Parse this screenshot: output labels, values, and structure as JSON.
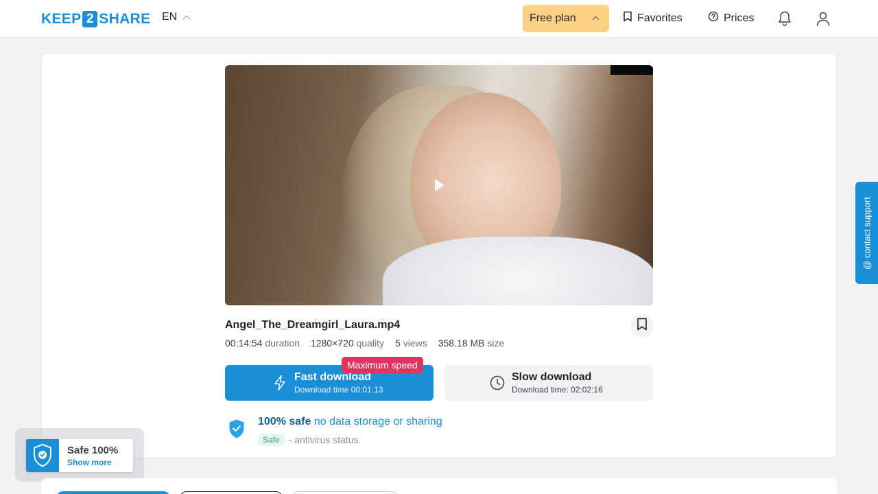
{
  "header": {
    "logo": {
      "left": "KEEP",
      "mid": "2",
      "right": "SHARE"
    },
    "language": "EN",
    "free_plan": "Free plan",
    "favorites": "Favorites",
    "prices": "Prices"
  },
  "file": {
    "name": "Angel_The_Dreamgirl_Laura.mp4",
    "duration_value": "00:14:54",
    "duration_label": "duration",
    "quality_value": "1280×720",
    "quality_label": "quality",
    "views_value": "5",
    "views_label": "views",
    "size_value": "358.18 MB",
    "size_label": "size"
  },
  "download": {
    "speed_badge": "Maximum speed",
    "fast_label": "Fast download",
    "fast_time": "Download time 00:01:13",
    "slow_label": "Slow download",
    "slow_time": "Download time: 02:02:16"
  },
  "safety": {
    "title_bold": "100% safe",
    "title_rest": "no data storage or sharing",
    "status_pill": "Safe",
    "status_text": "- antivirus status"
  },
  "contact": "@ contact support",
  "safe_widget": {
    "title": "Safe 100%",
    "link": "Show more"
  },
  "colors": {
    "brand": "#1a8fd8",
    "plan": "#fcd186",
    "badge": "#e03560"
  }
}
